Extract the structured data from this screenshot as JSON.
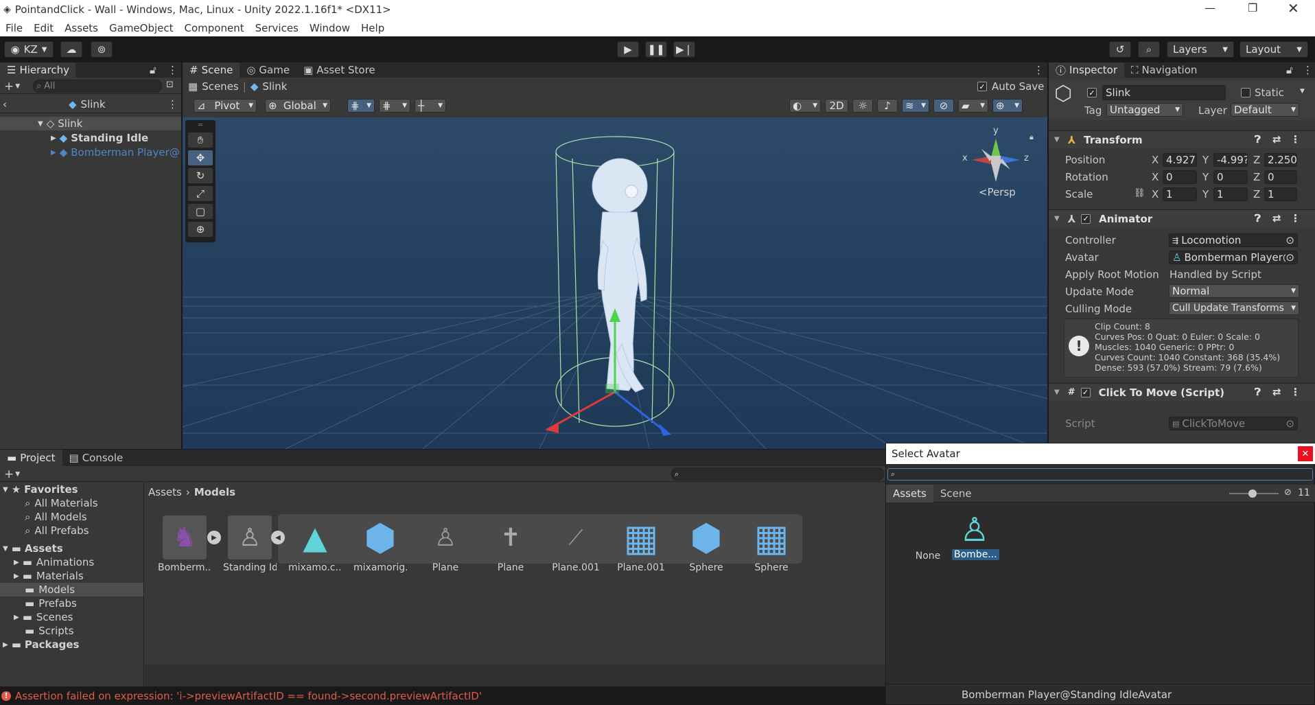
{
  "window": {
    "title": "PointandClick - Wall - Windows, Mac, Linux - Unity 2022.1.16f1* <DX11>"
  },
  "menu": [
    "File",
    "Edit",
    "Assets",
    "GameObject",
    "Component",
    "Services",
    "Window",
    "Help"
  ],
  "toolbar": {
    "account": "KZ",
    "layers": "Layers",
    "layout": "Layout"
  },
  "hierarchy": {
    "tab": "Hierarchy",
    "search_placeholder": "All",
    "context": "Slink",
    "items": [
      {
        "label": "Slink"
      },
      {
        "label": "Standing Idle"
      },
      {
        "label": "Bomberman Player@"
      }
    ]
  },
  "scene": {
    "tabs": [
      "Scene",
      "Game",
      "Asset Store"
    ],
    "breadcrumb": [
      "Scenes",
      "Slink"
    ],
    "auto_save": "Auto Save",
    "pivot": "Pivot",
    "global": "Global",
    "mode_2d": "2D",
    "gizmo_y": "y",
    "gizmo_x": "x",
    "gizmo_z": "z",
    "persp": "<Persp"
  },
  "inspector": {
    "tabs": [
      "Inspector",
      "Navigation"
    ],
    "object_name": "Slink",
    "static_label": "Static",
    "tag_label": "Tag",
    "tag_value": "Untagged",
    "layer_label": "Layer",
    "layer_value": "Default",
    "transform": {
      "title": "Transform",
      "rows": [
        {
          "label": "Position",
          "x": "4.927(",
          "y": "-4.99?",
          "z": "2.250!"
        },
        {
          "label": "Rotation",
          "x": "0",
          "y": "0",
          "z": "0"
        },
        {
          "label": "Scale",
          "x": "1",
          "y": "1",
          "z": "1"
        }
      ]
    },
    "animator": {
      "title": "Animator",
      "controller_label": "Controller",
      "controller_value": "Locomotion",
      "avatar_label": "Avatar",
      "avatar_value": "Bomberman Player@",
      "root_motion_label": "Apply Root Motion",
      "root_motion_value": "Handled by Script",
      "update_label": "Update Mode",
      "update_value": "Normal",
      "culling_label": "Culling Mode",
      "culling_value": "Cull Update Transforms",
      "info": [
        "Clip Count: 8",
        "Curves Pos: 0 Quat: 0 Euler: 0 Scale: 0",
        "Muscles: 1040 Generic: 0 PPtr: 0",
        "Curves Count: 1040 Constant: 368 (35.4%)",
        "Dense: 593 (57.0%) Stream: 79 (7.6%)"
      ]
    },
    "click_to_move": {
      "title": "Click To Move (Script)",
      "script_label": "Script",
      "script_value": "ClickToMove"
    }
  },
  "project": {
    "tabs": [
      "Project",
      "Console"
    ],
    "favorites_label": "Favorites",
    "favorites": [
      "All Materials",
      "All Models",
      "All Prefabs"
    ],
    "assets_label": "Assets",
    "folders": [
      "Animations",
      "Materials",
      "Models",
      "Prefabs",
      "Scenes",
      "Scripts"
    ],
    "packages_label": "Packages",
    "breadcrumb": [
      "Assets",
      "Models"
    ],
    "items": [
      {
        "label": "Bomberm..."
      },
      {
        "label": "Standing Id..."
      },
      {
        "label": "mixamo.c..."
      },
      {
        "label": "mixamorig..."
      },
      {
        "label": "Plane"
      },
      {
        "label": "Plane"
      },
      {
        "label": "Plane.001"
      },
      {
        "label": "Plane.001"
      },
      {
        "label": "Sphere"
      },
      {
        "label": "Sphere"
      }
    ]
  },
  "select_avatar": {
    "title": "Select Avatar",
    "tabs": [
      "Assets",
      "Scene"
    ],
    "hidden_count": "11",
    "items": [
      {
        "label": "None"
      },
      {
        "label": "Bombe..."
      }
    ],
    "footer": "Bomberman Player@Standing IdleAvatar"
  },
  "status": {
    "error": "Assertion failed on expression: 'i->previewArtifactID == found->second.previewArtifactID'"
  },
  "colors": {
    "accent": "#4d7fbf",
    "scene_bg": "#253e5b",
    "error": "#e05b4b",
    "avatar_icon": "#5fd3d5"
  }
}
